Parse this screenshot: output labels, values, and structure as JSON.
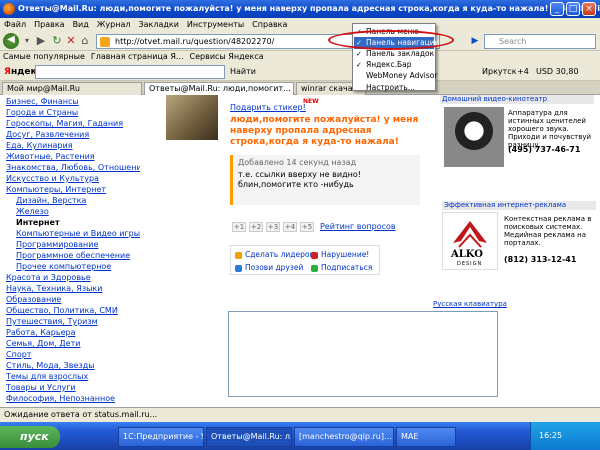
{
  "window": {
    "title": "Ответы@Mail.Ru: люди,помогите пожалуйста! у меня наверху пропала адресная строка,когда я куда-то нажала! - Mozilla Firefox"
  },
  "menubar": [
    "Файл",
    "Правка",
    "Вид",
    "Журнал",
    "Закладки",
    "Инструменты",
    "Справка"
  ],
  "nav": {
    "url": "http://otvet.mail.ru/question/48202270/",
    "search_placeholder": "Search"
  },
  "bookmarks": [
    "Самые популярные",
    "Главная страница Я...",
    "Сервисы Яндекса"
  ],
  "yandex": {
    "logo_ya": "Я",
    "logo_rest": "ндекс",
    "find_label": "Найти",
    "city": "Иркутск",
    "temp": "+4",
    "usd": "USD 30,80"
  },
  "context_menu": {
    "items": [
      {
        "label": "Панель меню",
        "checked": true,
        "highlight": false
      },
      {
        "label": "Панель навигации",
        "checked": true,
        "highlight": true
      },
      {
        "label": "Панель закладок",
        "checked": true,
        "highlight": false
      },
      {
        "label": "Яндекс.Бар",
        "checked": true,
        "highlight": false
      },
      {
        "label": "WebMoney Advisor",
        "checked": false,
        "highlight": false
      },
      {
        "label": "Настроить...",
        "checked": false,
        "highlight": false
      }
    ]
  },
  "tabs": [
    "Мой мир@Mail.Ru",
    "Ответы@Mail.Ru: люди,помогит...",
    "winrar скачат"
  ],
  "sidebar": {
    "items": [
      {
        "label": "Бизнес, Финансы",
        "level": 0
      },
      {
        "label": "Города и Страны",
        "level": 0
      },
      {
        "label": "Гороскопы, Магия, Гадания",
        "level": 0
      },
      {
        "label": "Досуг, Развлечения",
        "level": 0
      },
      {
        "label": "Еда, Кулинария",
        "level": 0
      },
      {
        "label": "Животные, Растения",
        "level": 0
      },
      {
        "label": "Знакомства, Любовь, Отношения",
        "level": 0
      },
      {
        "label": "Искусство и Культура",
        "level": 0
      },
      {
        "label": "Компьютеры, Интернет",
        "level": 0
      },
      {
        "label": "Дизайн, Верстка",
        "level": 1
      },
      {
        "label": "Железо",
        "level": 1
      },
      {
        "label": "Интернет",
        "level": 1,
        "bold": true
      },
      {
        "label": "Компьютерные и Видео игры",
        "level": 1
      },
      {
        "label": "Программирование",
        "level": 1
      },
      {
        "label": "Программное обеспечение",
        "level": 1
      },
      {
        "label": "Прочее компьютерное",
        "level": 1
      },
      {
        "label": "Красота и Здоровье",
        "level": 0
      },
      {
        "label": "Наука, Техника, Языки",
        "level": 0
      },
      {
        "label": "Образование",
        "level": 0
      },
      {
        "label": "Общество, Политика, СМИ",
        "level": 0
      },
      {
        "label": "Путешествия, Туризм",
        "level": 0
      },
      {
        "label": "Работа, Карьера",
        "level": 0
      },
      {
        "label": "Семья, Дом, Дети",
        "level": 0
      },
      {
        "label": "Спорт",
        "level": 0
      },
      {
        "label": "Стиль, Мода, Звезды",
        "level": 0
      },
      {
        "label": "Темы для взрослых",
        "level": 0
      },
      {
        "label": "Товары и Услуги",
        "level": 0
      },
      {
        "label": "Философия, Непознанное",
        "level": 0
      }
    ]
  },
  "question": {
    "gift_link": "Подарить стикер!",
    "new_badge": "NEW",
    "text": "люди,помогите пожалуйста! у меня наверху пропала адресная строка,когда я куда-то нажала!",
    "added": "Добавлено 14 секунд назад",
    "detail": "т.е. ссылки вверху не видно! блин,помогите кто -нибудь",
    "vote_labels": [
      "+1",
      "+2",
      "+3",
      "+4",
      "+5"
    ],
    "rating_link": "Рейтинг вопросов",
    "actions": [
      "Сделать лидером",
      "Нарушение!",
      "Позови друзей",
      "Подписаться"
    ],
    "keyboard_link": "Русская клавиатура"
  },
  "ads": {
    "ad1_header": "Домашний видео-кинотеатр",
    "ad1_text": "Аппаратура для истинных ценителей хорошего звука. Приходи и почувствуй разницу.",
    "ad1_phone": "(495) 737-46-71",
    "ad2_header": "Эффективная интернет-реклама",
    "ad2_text": "Контекстная реклама в поисковых системах. Медийная реклама на порталах.",
    "ad2_phone": "(812) 313-12-41",
    "alko_name": "ALKO",
    "alko_sub": "DESIGN"
  },
  "status": {
    "text": "Ожидание ответа от status.mail.ru..."
  },
  "taskbar": {
    "start": "пуск",
    "tasks": [
      "1С:Предприятие - У...",
      "Ответы@Mail.Ru: л...",
      "[manchestro@qip.ru]...",
      "МАЕ"
    ],
    "clock": "16:25"
  },
  "colors": {
    "accent": "#ff6600",
    "link": "#0033cc",
    "highlight": "#316ac5",
    "annotation": "#d01010"
  }
}
